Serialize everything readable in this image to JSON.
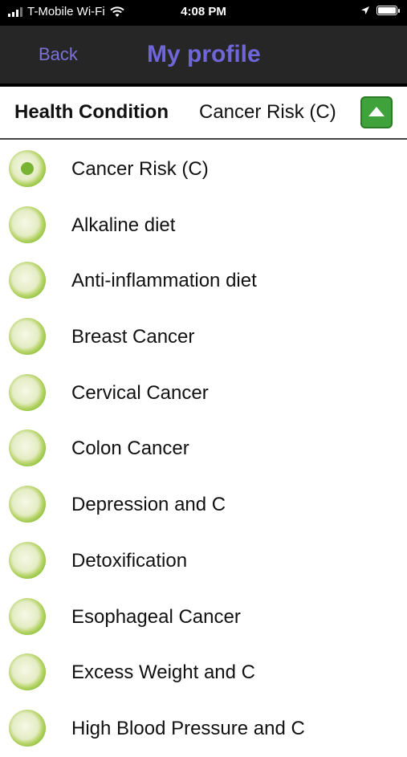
{
  "status_bar": {
    "carrier": "T-Mobile Wi-Fi",
    "time": "4:08 PM"
  },
  "navbar": {
    "back_label": "Back",
    "title": "My profile"
  },
  "condition": {
    "label": "Health Condition",
    "value": "Cancer Risk (C)"
  },
  "options": [
    {
      "label": "Cancer Risk (C)",
      "selected": true
    },
    {
      "label": "Alkaline diet",
      "selected": false
    },
    {
      "label": "Anti-inflammation diet",
      "selected": false
    },
    {
      "label": "Breast Cancer",
      "selected": false
    },
    {
      "label": "Cervical Cancer",
      "selected": false
    },
    {
      "label": "Colon Cancer",
      "selected": false
    },
    {
      "label": "Depression and C",
      "selected": false
    },
    {
      "label": "Detoxification",
      "selected": false
    },
    {
      "label": "Esophageal Cancer",
      "selected": false
    },
    {
      "label": "Excess Weight and C",
      "selected": false
    },
    {
      "label": "High Blood Pressure and C",
      "selected": false
    }
  ]
}
